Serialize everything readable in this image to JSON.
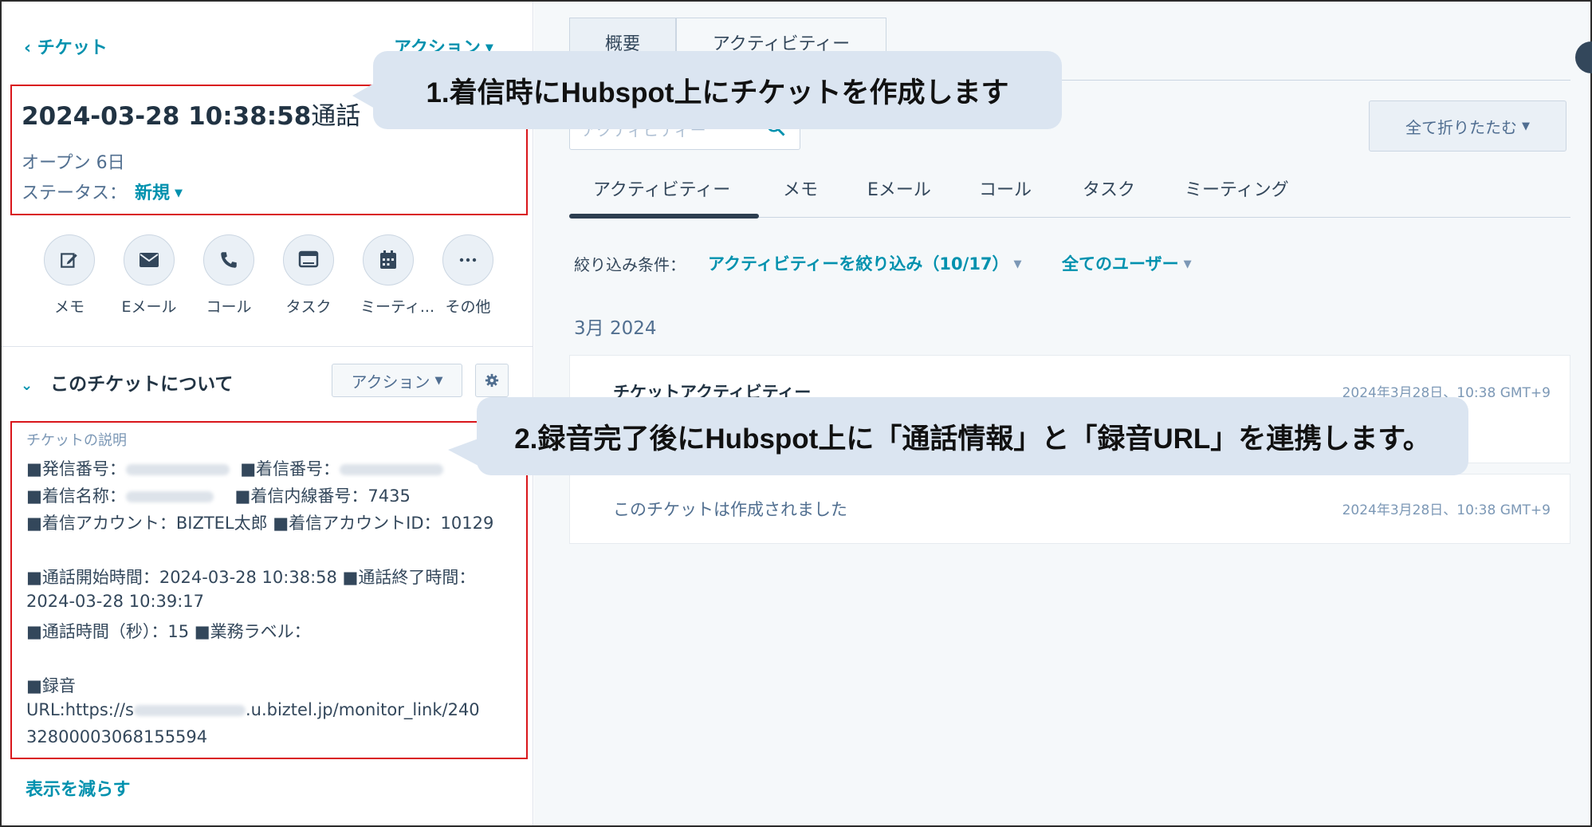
{
  "left": {
    "back_label": "‹ チケット",
    "action_label": "アクション",
    "title_main": "2024-03-28 10:38:58",
    "title_suffix": "通話",
    "open_days": "オープン 6日",
    "status_label": "ステータス：",
    "status_value": "新規",
    "quick_actions": [
      {
        "label": "メモ",
        "icon": "edit-icon"
      },
      {
        "label": "Eメール",
        "icon": "email-icon"
      },
      {
        "label": "コール",
        "icon": "phone-icon"
      },
      {
        "label": "タスク",
        "icon": "task-icon"
      },
      {
        "label": "ミーティ...",
        "icon": "calendar-icon"
      },
      {
        "label": "その他",
        "icon": "more-icon"
      }
    ],
    "section_title": "このチケットについて",
    "section_action": "アクション",
    "description_label": "チケットの説明",
    "description_lines": [
      "■発信番号：",
      "■着信番号：",
      "■着信名称：",
      "■着信内線番号：7435",
      "■着信アカウント：BIZTEL太郎 ■着信アカウントID：10129",
      "■通話開始時間：2024-03-28 10:38:58 ■通話終了時間：",
      "2024-03-28 10:39:17",
      "■通話時間（秒）：15 ■業務ラベル：",
      "■録音",
      "URL:https://s",
      ".u.biztel.jp/monitor_link/240",
      "32800003068155594"
    ],
    "show_less": "表示を減らす"
  },
  "right": {
    "top_tabs": [
      "概要",
      "アクティビティー"
    ],
    "search_placeholder": "アクティビティー",
    "collapse_all": "全て折りたたむ",
    "activity_tabs": [
      "アクティビティー",
      "メモ",
      "Eメール",
      "コール",
      "タスク",
      "ミーティング"
    ],
    "filter_label": "絞り込み条件：",
    "filter_activity": "アクティビティーを絞り込み（10/17）",
    "filter_users": "全てのユーザー",
    "month": "3月 2024",
    "cards": [
      {
        "title": "チケットアクティビティー",
        "date": "2024年3月28日、10:38 GMT+9"
      },
      {
        "text": "このチケットは作成されました",
        "date": "2024年3月28日、10:38 GMT+9"
      }
    ]
  },
  "callouts": {
    "first": "1.着信時にHubspot上にチケットを作成します",
    "second": "2.録音完了後にHubspot上に「通話情報」と「録音URL」を連携します。"
  },
  "colors": {
    "accent": "#0091ae",
    "highlight_border": "#d9161b",
    "callout_bg": "#dbe5f1"
  }
}
